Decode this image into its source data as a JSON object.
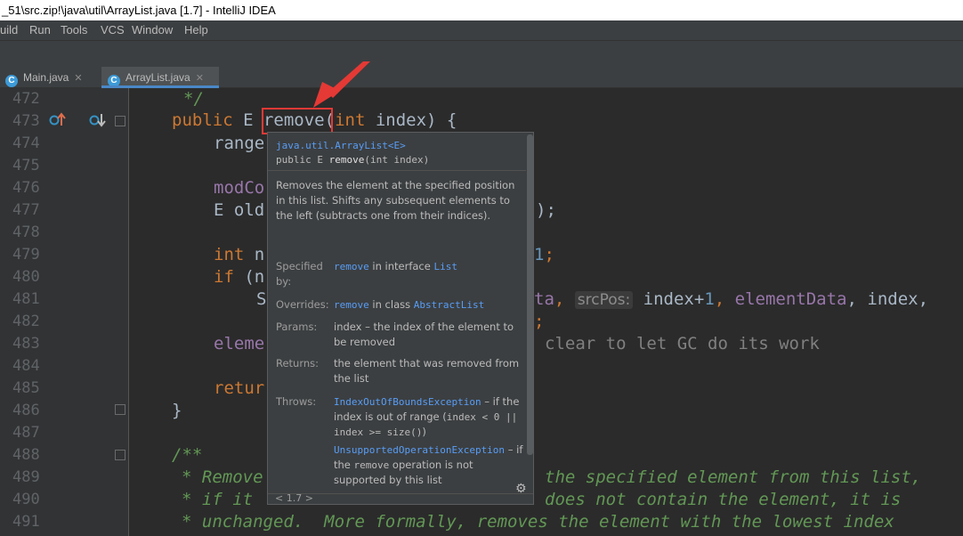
{
  "window": {
    "title": "_51\\src.zip!\\java\\util\\ArrayList.java [1.7] - IntelliJ IDEA"
  },
  "menu": {
    "items": [
      "uild",
      "Run",
      "Tools",
      "VCS",
      "Window",
      "Help"
    ]
  },
  "tabs": [
    {
      "label": "Main.java",
      "active": false
    },
    {
      "label": "ArrayList.java",
      "active": true
    }
  ],
  "gutter": {
    "line_numbers": [
      "472",
      "473",
      "474",
      "475",
      "476",
      "477",
      "478",
      "479",
      "480",
      "481",
      "482",
      "483",
      "484",
      "485",
      "486",
      "487",
      "488",
      "489",
      "490",
      "491"
    ]
  },
  "code": {
    "l472": "*/",
    "l473_kw": "public ",
    "l473_type": "E ",
    "l473_name": "remove",
    "l473_open": "(",
    "l473_kw2": "int",
    "l473_rest": " index) {",
    "l474": "range",
    "l476": "modCo",
    "l477_type": "E ",
    "l477_rest": "old",
    "l477_tail": ");",
    "l479_kw": "int",
    "l479_rest": " n",
    "l479_num": "1",
    "l479_semi": ";",
    "l480_kw": "if",
    "l480_rest": " (n",
    "l481_pre": "S",
    "l481_fld1": "ta",
    "l481_comma": ", ",
    "l481_hint": "srcPos:",
    "l481_mid": " index+",
    "l481_num": "1",
    "l481_comma2": ", ",
    "l481_fld2": "elementData",
    "l481_end": ", index,",
    "l482_semi": ";",
    "l483_fld": "eleme",
    "l483_cmt": "clear to let GC do its work",
    "l485_kw": "retur",
    "l486": "}",
    "l488": "/**",
    "l489_a": "* Remove",
    "l489_b": "the specified element from this list,",
    "l490_a": "* if it",
    "l490_b": "does not contain the element, it is",
    "l491": "* unchanged.  More formally, removes the element with the lowest index"
  },
  "doc_popup": {
    "class_link": "java.util.ArrayList<E>",
    "signature_pre": "public E ",
    "signature_name": "remove",
    "signature_post": "(int index)",
    "description": "Removes the element at the specified position in this list. Shifts any subsequent elements to the left (subtracts one from their indices).",
    "specified_label": "Specified by:",
    "specified_link": "remove",
    "specified_mid": " in interface ",
    "specified_iface": "List",
    "overrides_label": "Overrides:",
    "overrides_link": "remove",
    "overrides_mid": " in class ",
    "overrides_class": "AbstractList",
    "params_label": "Params:",
    "params_text": "index – the index of the element to be removed",
    "returns_label": "Returns:",
    "returns_text": "the element that was removed from the list",
    "throws_label": "Throws:",
    "throws_ex1": "IndexOutOfBoundsException",
    "throws_ex1_a": " – if the index is out of range (",
    "throws_ex1_code": "index < 0 || index >= size()",
    "throws_ex1_b": ")",
    "throws_ex2": "UnsupportedOperationException",
    "throws_ex2_a": " – if the ",
    "throws_ex2_code": "remove",
    "throws_ex2_b": " operation is not supported by this list",
    "footer": "< 1.7 >"
  },
  "colors": {
    "accent": "#4a88c7",
    "highlight": "#e53935",
    "link": "#589df6"
  },
  "icons": [
    "implements-up-icon",
    "overridden-down-icon",
    "class-c-icon",
    "gear-icon",
    "close-icon",
    "fold-icon"
  ]
}
